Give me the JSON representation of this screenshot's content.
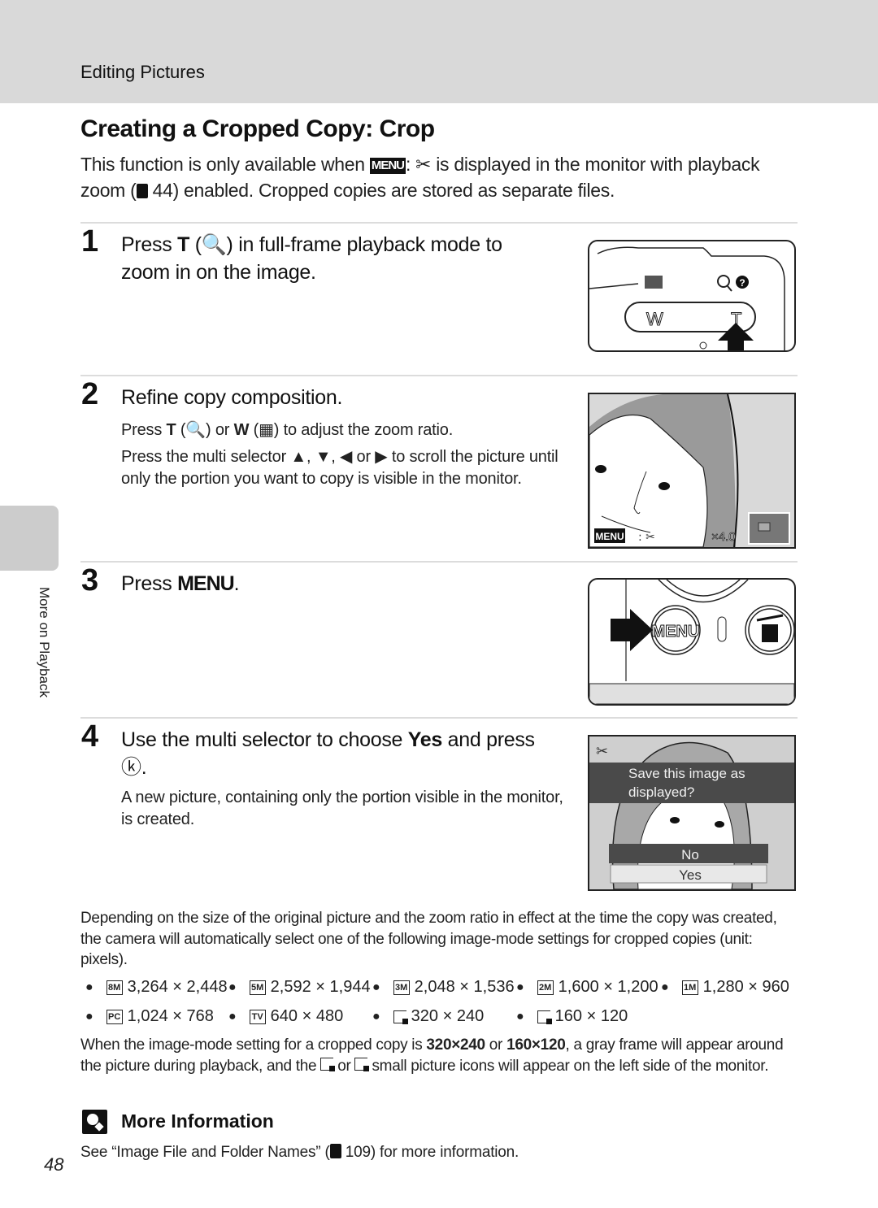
{
  "header": {
    "section": "Editing Pictures"
  },
  "title": "Creating a Cropped Copy: Crop",
  "intro": {
    "part1": "This function is only available when ",
    "menu_glyph": "MENU",
    "part2": ": ✂ is displayed in the monitor with playback zoom (",
    "ref_page": "44",
    "part3": ") enabled. Cropped copies are stored as separate files."
  },
  "steps": [
    {
      "number": "1",
      "title_a": "Press ",
      "title_key": "T",
      "title_b": " (🔍) in full-frame playback mode to zoom in on the image.",
      "figure": {
        "wide_label": "W",
        "tele_label": "T"
      }
    },
    {
      "number": "2",
      "title": "Refine copy composition.",
      "body1_a": "Press ",
      "body1_key1": "T",
      "body1_b": " (🔍) or ",
      "body1_key2": "W",
      "body1_c": " (▦) to adjust the zoom ratio.",
      "body2": "Press the multi selector ▲, ▼, ◀ or ▶ to scroll the picture until only the portion you want to copy is visible in the monitor.",
      "figure": {
        "menu_label": "MENU",
        "zoom_ratio": "×4.0"
      }
    },
    {
      "number": "3",
      "title_a": "Press ",
      "title_key": "MENU",
      "title_b": ".",
      "figure": {
        "button_label": "MENU"
      }
    },
    {
      "number": "4",
      "title_a": "Use the multi selector to choose ",
      "title_key": "Yes",
      "title_b": " and press ⓚ.",
      "body": "A new picture, containing only the portion visible in the monitor, is created.",
      "figure": {
        "prompt": "Save this image as displayed?",
        "option_no": "No",
        "option_yes": "Yes"
      }
    }
  ],
  "side_tab": {
    "label": "More on Playback"
  },
  "explanation": "Depending on the size of the original picture and the zoom ratio in effect at the time the copy was created, the camera will automatically select one of the following image-mode settings for cropped copies (unit: pixels).",
  "image_modes": [
    {
      "icon": "8M",
      "size": "3,264 × 2,448"
    },
    {
      "icon": "5M",
      "size": "2,592 × 1,944"
    },
    {
      "icon": "3M",
      "size": "2,048 × 1,536"
    },
    {
      "icon": "2M",
      "size": "1,600 × 1,200"
    },
    {
      "icon": "1M",
      "size": "1,280 × 960"
    },
    {
      "icon": "PC",
      "size": "1,024 × 768"
    },
    {
      "icon": "TV",
      "size": "640 × 480"
    },
    {
      "icon": "small-320",
      "size": "320 × 240"
    },
    {
      "icon": "small-160",
      "size": "160 × 120"
    }
  ],
  "gray_frame_note": {
    "a": "When the image-mode setting for a cropped copy is ",
    "b1": "320×240",
    "c": " or ",
    "b2": "160×120",
    "d": ", a gray frame will appear around the picture during playback, and the ",
    "e": " or ",
    "f": " small picture icons will appear on the left side of the monitor."
  },
  "more_info": {
    "title": "More Information",
    "text_a": "See “Image File and Folder Names” (",
    "ref_page": "109",
    "text_b": ") for more information."
  },
  "page_number": "48"
}
